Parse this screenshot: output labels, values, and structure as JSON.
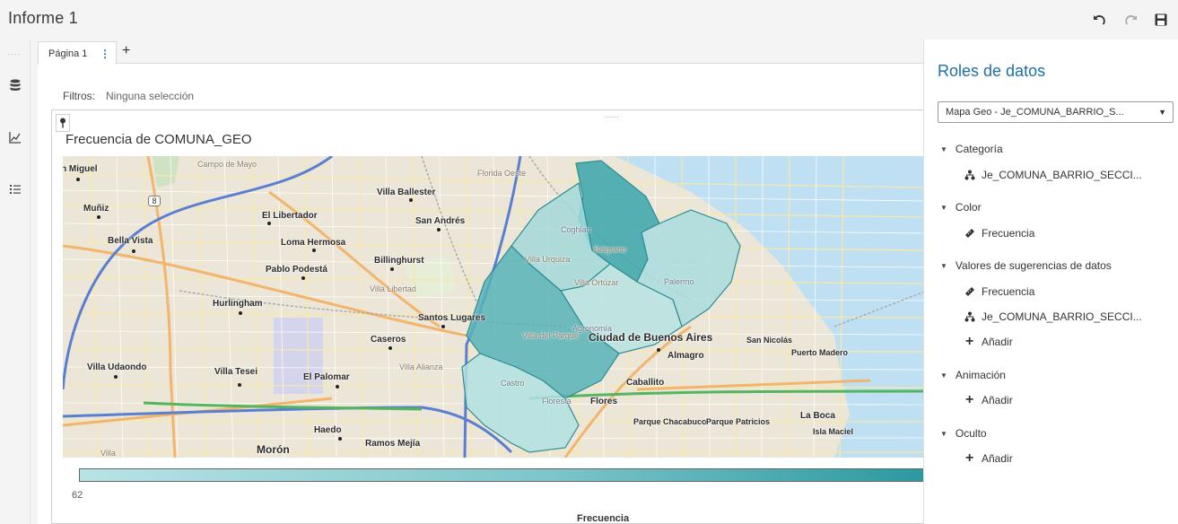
{
  "app": {
    "title": "Informe 1"
  },
  "toolbar": {
    "undo_icon": "undo-icon",
    "redo_icon": "redo-icon",
    "save_icon": "save-icon"
  },
  "left_rail": {
    "items": [
      "data-icon",
      "chart-icon",
      "list-icon"
    ]
  },
  "tabs": [
    {
      "label": "Página 1",
      "menu": "⋮"
    }
  ],
  "tab_add": "+",
  "filters": {
    "label": "Filtros:",
    "value": "Ninguna selección"
  },
  "object": {
    "title": "Frecuencia de COMUNA_GEO",
    "legend": {
      "min": "62",
      "title": "Frecuencia",
      "color_low": "#b9e3e5",
      "color_high": "#2a999f"
    }
  },
  "map": {
    "places": [
      "n Miguel",
      "Campo de Mayo",
      "Florida Oeste",
      "Villa Ballester",
      "Muñiz",
      "8",
      "El Libertador",
      "San Andrés",
      "Bella Vista",
      "Loma Hermosa",
      "Billinghurst",
      "Pablo Podestá",
      "Villa Libertad",
      "Hurlingham",
      "Santos Lugares",
      "Caseros",
      "Villa Alianza",
      "Villa Udaondo",
      "Villa Tesei",
      "El Palomar",
      "Haedo",
      "Ramos Mejía",
      "Morón",
      "Villa",
      "Ciudad de Buenos Aires",
      "Almagro",
      "San Nicolás",
      "Puerto Madero",
      "Caballito",
      "Flores",
      "Parque Chacabuco",
      "Parque Patricios",
      "La Boca",
      "Isla Maciel",
      "Coghlan",
      "Villa Urquiza",
      "Villa Ortúzar",
      "Belgrano",
      "Palermo",
      "Villa del Parque",
      "Agronomía",
      "Castro",
      "Floresta"
    ]
  },
  "panel": {
    "title": "Roles de datos",
    "select": "Mapa Geo - Je_COMUNA_BARRIO_S...",
    "sections": [
      {
        "label": "Categoría",
        "items": [
          {
            "type": "category",
            "label": "Je_COMUNA_BARRIO_SECCI..."
          }
        ]
      },
      {
        "label": "Color",
        "items": [
          {
            "type": "measure",
            "label": "Frecuencia"
          }
        ]
      },
      {
        "label": "Valores de sugerencias de datos",
        "items": [
          {
            "type": "measure",
            "label": "Frecuencia"
          },
          {
            "type": "category",
            "label": "Je_COMUNA_BARRIO_SECCI..."
          },
          {
            "type": "add",
            "label": "Añadir"
          }
        ]
      },
      {
        "label": "Animación",
        "items": [
          {
            "type": "add",
            "label": "Añadir"
          }
        ]
      },
      {
        "label": "Oculto",
        "items": [
          {
            "type": "add",
            "label": "Añadir"
          }
        ]
      }
    ]
  }
}
